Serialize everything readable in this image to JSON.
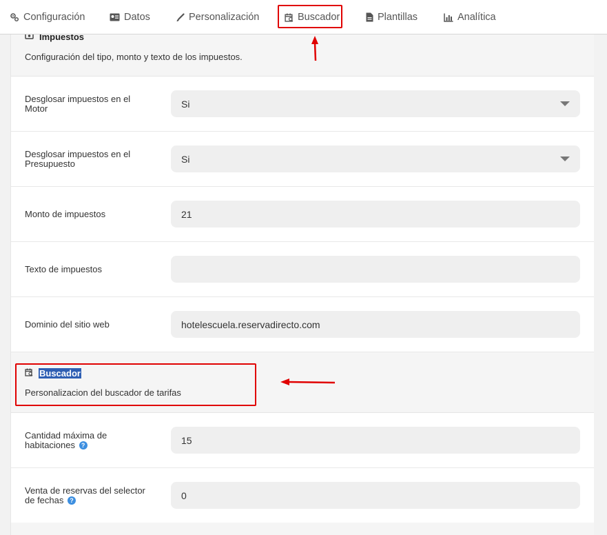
{
  "tabs": [
    {
      "label": "Configuración",
      "icon": "gears-icon"
    },
    {
      "label": "Datos",
      "icon": "id-card-icon"
    },
    {
      "label": "Personalización",
      "icon": "brush-icon"
    },
    {
      "label": "Buscador",
      "icon": "calendar-search-icon"
    },
    {
      "label": "Plantillas",
      "icon": "document-icon"
    },
    {
      "label": "Analítica",
      "icon": "bar-chart-icon"
    }
  ],
  "impuestos": {
    "title": "Impuestos",
    "description": "Configuración del tipo, monto y texto de los impuestos.",
    "rows": [
      {
        "label": "Desglosar impuestos en el Motor",
        "value": "Si",
        "type": "select"
      },
      {
        "label": "Desglosar impuestos en el Presupuesto",
        "value": "Si",
        "type": "select"
      },
      {
        "label": "Monto de impuestos",
        "value": "21",
        "type": "input"
      },
      {
        "label": "Texto de impuestos",
        "value": "",
        "type": "input"
      },
      {
        "label": "Dominio del sitio web",
        "value": "hotelescuela.reservadirecto.com",
        "type": "input"
      }
    ]
  },
  "buscador": {
    "title": "Buscador",
    "description": "Personalizacion del buscador de tarifas",
    "rows": [
      {
        "label": "Cantidad máxima de habitaciones",
        "value": "15",
        "help": "?"
      },
      {
        "label": "Venta de reservas del selector de fechas",
        "value": "0",
        "help": "?"
      }
    ]
  },
  "colors": {
    "accent_red": "#e00000",
    "selection": "#2f5fb3",
    "help_blue": "#3d8fe0"
  }
}
